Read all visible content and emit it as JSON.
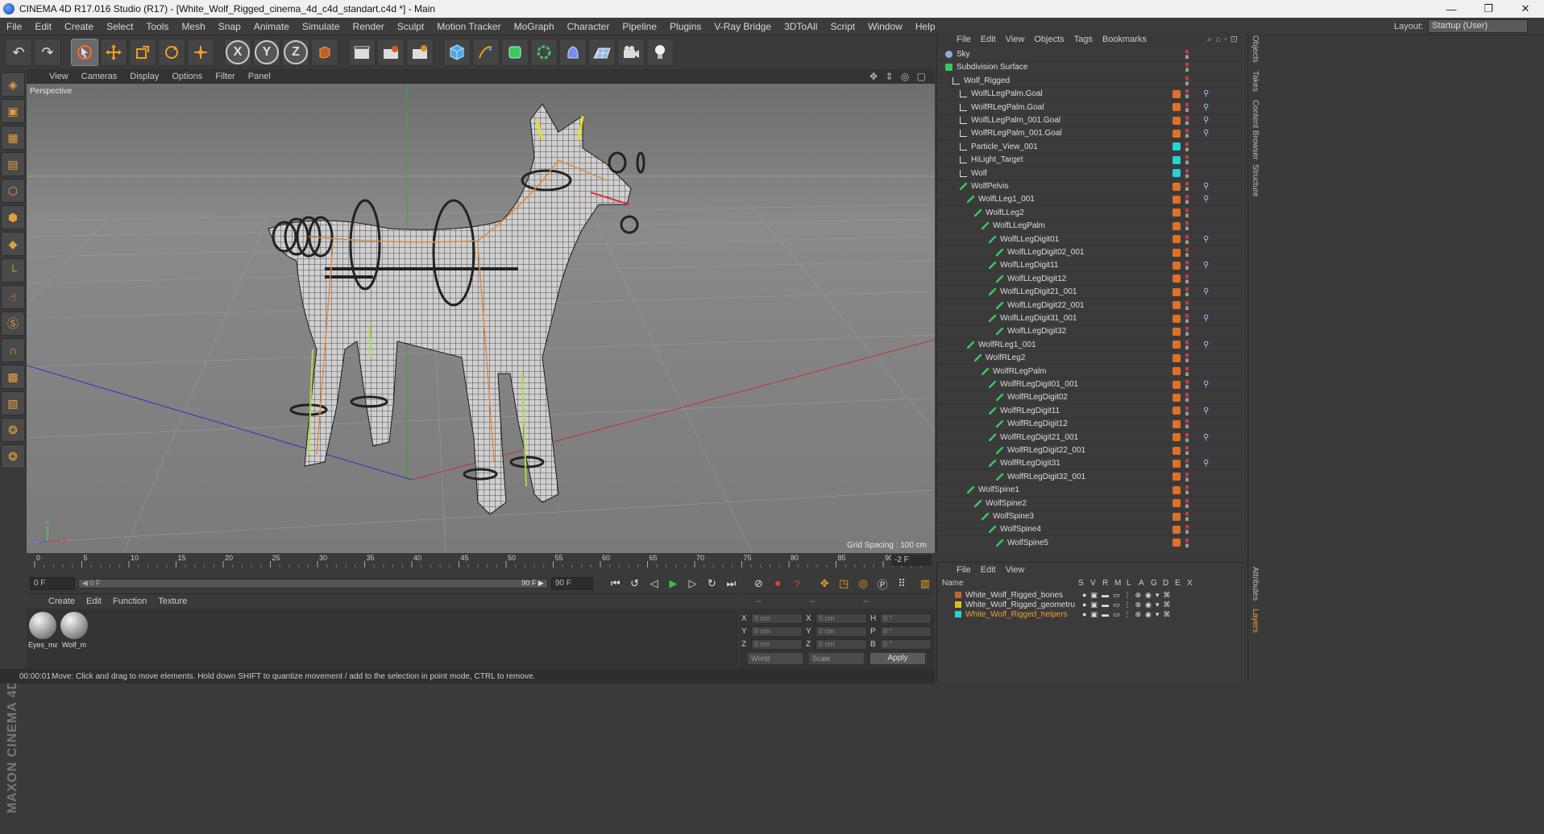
{
  "window": {
    "title": "CINEMA 4D R17.016 Studio (R17) - [White_Wolf_Rigged_cinema_4d_c4d_standart.c4d *] - Main",
    "controls": [
      "—",
      "❐",
      "✕"
    ]
  },
  "menu": {
    "items": [
      "File",
      "Edit",
      "Create",
      "Select",
      "Tools",
      "Mesh",
      "Snap",
      "Animate",
      "Simulate",
      "Render",
      "Sculpt",
      "Motion Tracker",
      "MoGraph",
      "Character",
      "Pipeline",
      "Plugins",
      "V-Ray Bridge",
      "3DToAll",
      "Script",
      "Window",
      "Help"
    ],
    "layout_label": "Layout:",
    "layout_value": "Startup (User)"
  },
  "toolbar": {
    "undo": "↶",
    "redo": "↷",
    "axis_x": "X",
    "axis_y": "Y",
    "axis_z": "Z"
  },
  "viewport": {
    "menu": [
      "View",
      "Cameras",
      "Display",
      "Options",
      "Filter",
      "Panel"
    ],
    "label": "Perspective",
    "grid_spacing": "Grid Spacing : 100 cm",
    "nav_icons": "✥ ⇕ ◎ ▢",
    "axis_y": "Y",
    "axis_x": "X",
    "axis_z": "Z"
  },
  "timeline": {
    "ticks": [
      "0",
      "5",
      "10",
      "15",
      "20",
      "25",
      "30",
      "35",
      "40",
      "45",
      "50",
      "55",
      "60",
      "65",
      "70",
      "75",
      "80",
      "85",
      "90"
    ],
    "current": "-2 F"
  },
  "playback": {
    "start_frame": "0 F",
    "range_min": "◀ 0 F",
    "range_max": "90 F ▶",
    "end_frame": "90 F"
  },
  "materials": {
    "menu": [
      "Create",
      "Edit",
      "Function",
      "Texture"
    ],
    "items": [
      {
        "label": "Eyes_ma"
      },
      {
        "label": "Wolf_m"
      }
    ]
  },
  "coords": {
    "headers": [
      "--",
      "--",
      "--"
    ],
    "rows": [
      {
        "a": "X",
        "av": "0 cm",
        "b": "X",
        "bv": "0 cm",
        "c": "H",
        "cv": "0 °"
      },
      {
        "a": "Y",
        "av": "0 cm",
        "b": "Y",
        "bv": "0 cm",
        "c": "P",
        "cv": "0 °"
      },
      {
        "a": "Z",
        "av": "0 cm",
        "b": "Z",
        "bv": "0 cm",
        "c": "B",
        "cv": "0 °"
      }
    ],
    "world": "World",
    "scale": "Scale",
    "apply": "Apply"
  },
  "status": {
    "time": "00:00:01",
    "message": "Move: Click and drag to move elements. Hold down SHIFT to quantize movement / add to the selection in point mode, CTRL to remove."
  },
  "object_manager": {
    "menu": [
      "File",
      "Edit",
      "View",
      "Objects",
      "Tags",
      "Bookmarks"
    ],
    "objects": [
      {
        "name": "Sky",
        "depth": 0,
        "icon": "sky",
        "tag": "none",
        "ik": false
      },
      {
        "name": "Subdivision Surface",
        "depth": 0,
        "icon": "subdiv",
        "tag": "none",
        "ik": false
      },
      {
        "name": "Wolf_Rigged",
        "depth": 1,
        "icon": "null",
        "tag": "none",
        "ik": false
      },
      {
        "name": "WolfLLegPalm.Goal",
        "depth": 2,
        "icon": "null",
        "tag": "orange",
        "ik": true
      },
      {
        "name": "WolfRLegPalm.Goal",
        "depth": 2,
        "icon": "null",
        "tag": "orange",
        "ik": true
      },
      {
        "name": "WolfLLegPalm_001.Goal",
        "depth": 2,
        "icon": "null",
        "tag": "orange",
        "ik": true
      },
      {
        "name": "WolfRLegPalm_001.Goal",
        "depth": 2,
        "icon": "null",
        "tag": "orange",
        "ik": true
      },
      {
        "name": "Particle_View_001",
        "depth": 2,
        "icon": "null",
        "tag": "cyan",
        "ik": false
      },
      {
        "name": "HiLight_Target",
        "depth": 2,
        "icon": "null",
        "tag": "cyan",
        "ik": false
      },
      {
        "name": "Wolf",
        "depth": 2,
        "icon": "null",
        "tag": "cyan",
        "ik": false
      },
      {
        "name": "WolfPelvis",
        "depth": 2,
        "icon": "bone",
        "tag": "orange",
        "ik": true
      },
      {
        "name": "WolfLLeg1_001",
        "depth": 3,
        "icon": "bone",
        "tag": "orange",
        "ik": true
      },
      {
        "name": "WolfLLeg2",
        "depth": 4,
        "icon": "bone",
        "tag": "orange",
        "ik": false
      },
      {
        "name": "WolfLLegPalm",
        "depth": 5,
        "icon": "bone",
        "tag": "orange",
        "ik": false
      },
      {
        "name": "WolfLLegDigit01",
        "depth": 6,
        "icon": "bone",
        "tag": "orange",
        "ik": true
      },
      {
        "name": "WolfLLegDigit02_001",
        "depth": 7,
        "icon": "bone",
        "tag": "orange",
        "ik": false
      },
      {
        "name": "WolfLLegDigit11",
        "depth": 6,
        "icon": "bone",
        "tag": "orange",
        "ik": true
      },
      {
        "name": "WolfLLegDigit12",
        "depth": 7,
        "icon": "bone",
        "tag": "orange",
        "ik": false
      },
      {
        "name": "WolfLLegDigit21_001",
        "depth": 6,
        "icon": "bone",
        "tag": "orange",
        "ik": true
      },
      {
        "name": "WolfLLegDigit22_001",
        "depth": 7,
        "icon": "bone",
        "tag": "orange",
        "ik": false
      },
      {
        "name": "WolfLLegDigit31_001",
        "depth": 6,
        "icon": "bone",
        "tag": "orange",
        "ik": true
      },
      {
        "name": "WolfLLegDigit32",
        "depth": 7,
        "icon": "bone",
        "tag": "orange",
        "ik": false
      },
      {
        "name": "WolfRLeg1_001",
        "depth": 3,
        "icon": "bone",
        "tag": "orange",
        "ik": true
      },
      {
        "name": "WolfRLeg2",
        "depth": 4,
        "icon": "bone",
        "tag": "orange",
        "ik": false
      },
      {
        "name": "WolfRLegPalm",
        "depth": 5,
        "icon": "bone",
        "tag": "orange",
        "ik": false
      },
      {
        "name": "WolfRLegDigit01_001",
        "depth": 6,
        "icon": "bone",
        "tag": "orange",
        "ik": true
      },
      {
        "name": "WolfRLegDigit02",
        "depth": 7,
        "icon": "bone",
        "tag": "orange",
        "ik": false
      },
      {
        "name": "WolfRLegDigit11",
        "depth": 6,
        "icon": "bone",
        "tag": "orange",
        "ik": true
      },
      {
        "name": "WolfRLegDigit12",
        "depth": 7,
        "icon": "bone",
        "tag": "orange",
        "ik": false
      },
      {
        "name": "WolfRLegDigit21_001",
        "depth": 6,
        "icon": "bone",
        "tag": "orange",
        "ik": true
      },
      {
        "name": "WolfRLegDigit22_001",
        "depth": 7,
        "icon": "bone",
        "tag": "orange",
        "ik": false
      },
      {
        "name": "WolfRLegDigit31",
        "depth": 6,
        "icon": "bone",
        "tag": "orange",
        "ik": true
      },
      {
        "name": "WolfRLegDigit32_001",
        "depth": 7,
        "icon": "bone",
        "tag": "orange",
        "ik": false
      },
      {
        "name": "WolfSpine1",
        "depth": 3,
        "icon": "bone",
        "tag": "orange",
        "ik": false
      },
      {
        "name": "WolfSpine2",
        "depth": 4,
        "icon": "bone",
        "tag": "orange",
        "ik": false
      },
      {
        "name": "WolfSpine3",
        "depth": 5,
        "icon": "bone",
        "tag": "orange",
        "ik": false
      },
      {
        "name": "WolfSpine4",
        "depth": 6,
        "icon": "bone",
        "tag": "orange",
        "ik": false
      },
      {
        "name": "WolfSpine5",
        "depth": 7,
        "icon": "bone",
        "tag": "orange",
        "ik": false
      }
    ]
  },
  "side_tabs": [
    "Objects",
    "Takes",
    "Content Browser",
    "Structure",
    "Attributes",
    "Layers"
  ],
  "layer_manager": {
    "menu": [
      "File",
      "Edit",
      "View"
    ],
    "columns": [
      "Name",
      "S",
      "V",
      "R",
      "M",
      "L",
      "A",
      "G",
      "D",
      "E",
      "X"
    ],
    "layers": [
      {
        "name": "White_Wolf_Rigged_bones",
        "color": "#c8642a",
        "highlight": false
      },
      {
        "name": "White_Wolf_Rigged_geometru",
        "color": "#d8c022",
        "highlight": false
      },
      {
        "name": "White_Wolf_Rigged_helpers",
        "color": "#2ad0d8",
        "highlight": true
      }
    ]
  },
  "colors": {
    "accent_orange": "#e08a2a",
    "cyan_tag": "#2ad0d8",
    "highlight_text": "#f0a030"
  }
}
